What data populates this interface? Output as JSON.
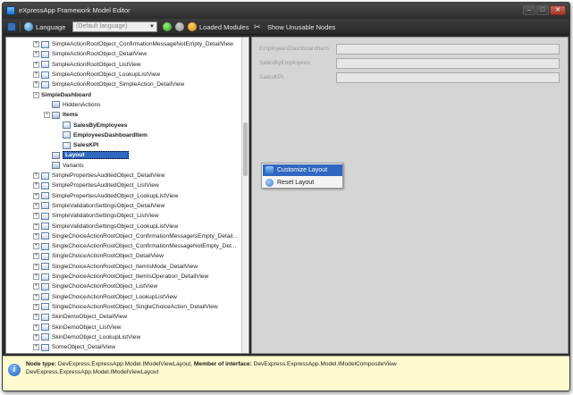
{
  "window": {
    "title": "eXpressApp Framework Model Editor"
  },
  "toolbar": {
    "language_label": "Language",
    "language_value": "(Default language)",
    "loaded_modules": "Loaded Modules",
    "show_unusable": "Show Unusable Nodes"
  },
  "tree": {
    "rows": [
      "SimpleActionRootObject_ConfirmationMessageNotEmpty_DetailView",
      "SimpleActionRootObject_DetailView",
      "SimpleActionRootObject_ListView",
      "SimpleActionRootObject_LookupListView",
      "SimpleActionRootObject_SimpleAction_DetailView",
      "SimpleDashboard",
      "HiddenActions",
      "Items",
      "SalesByEmployees",
      "EmployeesDashboardItem",
      "SalesKPI",
      "Layout",
      "Variants",
      "SimplePropertiesAuditedObject_DetailView",
      "SimplePropertiesAuditedObject_ListView",
      "SimplePropertiesAuditedObject_LookupListView",
      "SimpleValidationSettingsObject_DetailView",
      "SimpleValidationSettingsObject_ListView",
      "SimpleValidationSettingsObject_LookupListView",
      "SingleChoiceActionRootObject_ConfirmationMessageIsEmpty_Detail...",
      "SingleChoiceActionRootObject_ConfirmationMessageNotEmpty_Det...",
      "SingleChoiceActionRootObject_DetailView",
      "SingleChoiceActionRootObject_ItemIsMode_DetailView",
      "SingleChoiceActionRootObject_ItemIsOperation_DetailView",
      "SingleChoiceActionRootObject_ListView",
      "SingleChoiceActionRootObject_LookupListView",
      "SingleChoiceActionRootObject_SingleChoiceAction_DetailView",
      "SkinDemoObject_DetailView",
      "SkinDemoObject_ListView",
      "SkinDemoObject_LookupListView",
      "SomeObject_DetailView"
    ]
  },
  "layout_panel": {
    "fields": [
      "EmployeesDashboardItem",
      "SalesByEmployees",
      "SalesKPI"
    ]
  },
  "context_menu": {
    "customize": "Customize Layout",
    "reset": "Reset Layout"
  },
  "status": {
    "node_type_label": "Node type:",
    "node_type_value": "DevExpress.ExpressApp.Model.IModelViewLayout,",
    "member_label": "Member of interface:",
    "member_value": "DevExpress.ExpressApp.Model.IModelCompositeView",
    "line2": "DevExpress.ExpressApp.Model.IModelViewLayout"
  },
  "colors": {
    "selection": "#2f67c1",
    "status_background": "#fffbd0",
    "toolbar": "#2b2b2b"
  }
}
